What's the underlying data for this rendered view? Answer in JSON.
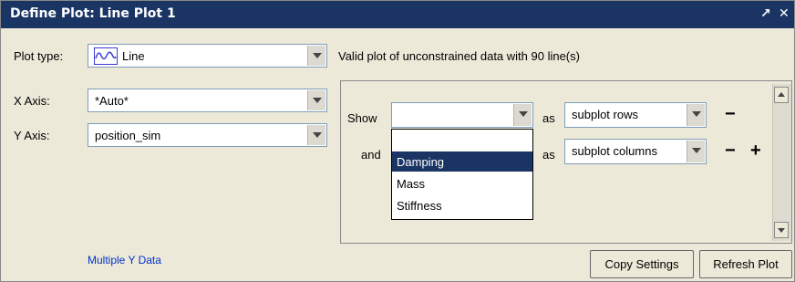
{
  "window": {
    "title": "Define Plot: Line Plot 1",
    "undock_icon": "↗",
    "close_icon": "✕"
  },
  "plot_type": {
    "label": "Plot type:",
    "value": "Line"
  },
  "x_axis": {
    "label": "X Axis:",
    "value": "*Auto*"
  },
  "y_axis": {
    "label": "Y Axis:",
    "value": "position_sim"
  },
  "status": "Valid plot of unconstrained data with 90 line(s)",
  "subplot": {
    "show_label": "Show",
    "and_label": "and",
    "as_label": "as",
    "row1_show_value": "",
    "row1_as_value": "subplot rows",
    "row2_as_value": "subplot columns",
    "minus": "−",
    "plus": "+",
    "dropdown_options": [
      "",
      "Damping",
      "Mass",
      "Stiffness"
    ],
    "dropdown_selected": "Damping"
  },
  "multiple_y_link": "Multiple Y Data",
  "buttons": {
    "copy_settings": "Copy Settings",
    "refresh_plot": "Refresh Plot"
  },
  "colors": {
    "title_bar": "#1a3563",
    "selection": "#1a3563",
    "link": "#0033cc",
    "line_icon": "#3a3ad6"
  }
}
